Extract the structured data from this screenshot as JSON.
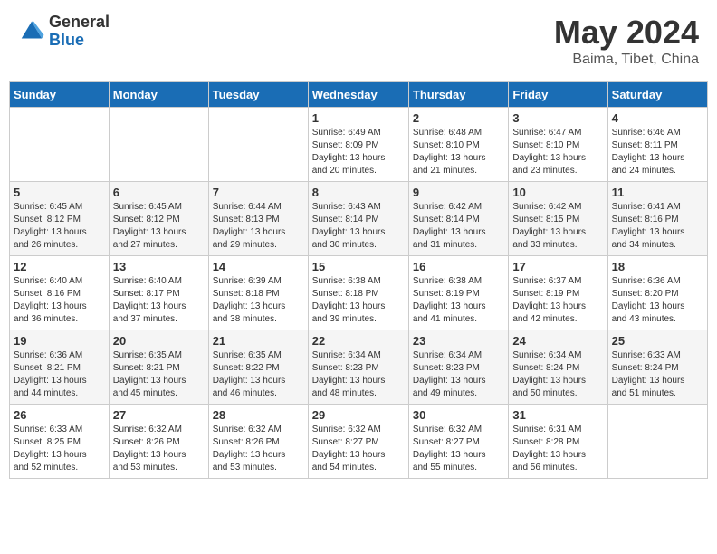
{
  "header": {
    "logo_general": "General",
    "logo_blue": "Blue",
    "month_title": "May 2024",
    "location": "Baima, Tibet, China"
  },
  "weekdays": [
    "Sunday",
    "Monday",
    "Tuesday",
    "Wednesday",
    "Thursday",
    "Friday",
    "Saturday"
  ],
  "weeks": [
    [
      {
        "day": "",
        "info": ""
      },
      {
        "day": "",
        "info": ""
      },
      {
        "day": "",
        "info": ""
      },
      {
        "day": "1",
        "info": "Sunrise: 6:49 AM\nSunset: 8:09 PM\nDaylight: 13 hours\nand 20 minutes."
      },
      {
        "day": "2",
        "info": "Sunrise: 6:48 AM\nSunset: 8:10 PM\nDaylight: 13 hours\nand 21 minutes."
      },
      {
        "day": "3",
        "info": "Sunrise: 6:47 AM\nSunset: 8:10 PM\nDaylight: 13 hours\nand 23 minutes."
      },
      {
        "day": "4",
        "info": "Sunrise: 6:46 AM\nSunset: 8:11 PM\nDaylight: 13 hours\nand 24 minutes."
      }
    ],
    [
      {
        "day": "5",
        "info": "Sunrise: 6:45 AM\nSunset: 8:12 PM\nDaylight: 13 hours\nand 26 minutes."
      },
      {
        "day": "6",
        "info": "Sunrise: 6:45 AM\nSunset: 8:12 PM\nDaylight: 13 hours\nand 27 minutes."
      },
      {
        "day": "7",
        "info": "Sunrise: 6:44 AM\nSunset: 8:13 PM\nDaylight: 13 hours\nand 29 minutes."
      },
      {
        "day": "8",
        "info": "Sunrise: 6:43 AM\nSunset: 8:14 PM\nDaylight: 13 hours\nand 30 minutes."
      },
      {
        "day": "9",
        "info": "Sunrise: 6:42 AM\nSunset: 8:14 PM\nDaylight: 13 hours\nand 31 minutes."
      },
      {
        "day": "10",
        "info": "Sunrise: 6:42 AM\nSunset: 8:15 PM\nDaylight: 13 hours\nand 33 minutes."
      },
      {
        "day": "11",
        "info": "Sunrise: 6:41 AM\nSunset: 8:16 PM\nDaylight: 13 hours\nand 34 minutes."
      }
    ],
    [
      {
        "day": "12",
        "info": "Sunrise: 6:40 AM\nSunset: 8:16 PM\nDaylight: 13 hours\nand 36 minutes."
      },
      {
        "day": "13",
        "info": "Sunrise: 6:40 AM\nSunset: 8:17 PM\nDaylight: 13 hours\nand 37 minutes."
      },
      {
        "day": "14",
        "info": "Sunrise: 6:39 AM\nSunset: 8:18 PM\nDaylight: 13 hours\nand 38 minutes."
      },
      {
        "day": "15",
        "info": "Sunrise: 6:38 AM\nSunset: 8:18 PM\nDaylight: 13 hours\nand 39 minutes."
      },
      {
        "day": "16",
        "info": "Sunrise: 6:38 AM\nSunset: 8:19 PM\nDaylight: 13 hours\nand 41 minutes."
      },
      {
        "day": "17",
        "info": "Sunrise: 6:37 AM\nSunset: 8:19 PM\nDaylight: 13 hours\nand 42 minutes."
      },
      {
        "day": "18",
        "info": "Sunrise: 6:36 AM\nSunset: 8:20 PM\nDaylight: 13 hours\nand 43 minutes."
      }
    ],
    [
      {
        "day": "19",
        "info": "Sunrise: 6:36 AM\nSunset: 8:21 PM\nDaylight: 13 hours\nand 44 minutes."
      },
      {
        "day": "20",
        "info": "Sunrise: 6:35 AM\nSunset: 8:21 PM\nDaylight: 13 hours\nand 45 minutes."
      },
      {
        "day": "21",
        "info": "Sunrise: 6:35 AM\nSunset: 8:22 PM\nDaylight: 13 hours\nand 46 minutes."
      },
      {
        "day": "22",
        "info": "Sunrise: 6:34 AM\nSunset: 8:23 PM\nDaylight: 13 hours\nand 48 minutes."
      },
      {
        "day": "23",
        "info": "Sunrise: 6:34 AM\nSunset: 8:23 PM\nDaylight: 13 hours\nand 49 minutes."
      },
      {
        "day": "24",
        "info": "Sunrise: 6:34 AM\nSunset: 8:24 PM\nDaylight: 13 hours\nand 50 minutes."
      },
      {
        "day": "25",
        "info": "Sunrise: 6:33 AM\nSunset: 8:24 PM\nDaylight: 13 hours\nand 51 minutes."
      }
    ],
    [
      {
        "day": "26",
        "info": "Sunrise: 6:33 AM\nSunset: 8:25 PM\nDaylight: 13 hours\nand 52 minutes."
      },
      {
        "day": "27",
        "info": "Sunrise: 6:32 AM\nSunset: 8:26 PM\nDaylight: 13 hours\nand 53 minutes."
      },
      {
        "day": "28",
        "info": "Sunrise: 6:32 AM\nSunset: 8:26 PM\nDaylight: 13 hours\nand 53 minutes."
      },
      {
        "day": "29",
        "info": "Sunrise: 6:32 AM\nSunset: 8:27 PM\nDaylight: 13 hours\nand 54 minutes."
      },
      {
        "day": "30",
        "info": "Sunrise: 6:32 AM\nSunset: 8:27 PM\nDaylight: 13 hours\nand 55 minutes."
      },
      {
        "day": "31",
        "info": "Sunrise: 6:31 AM\nSunset: 8:28 PM\nDaylight: 13 hours\nand 56 minutes."
      },
      {
        "day": "",
        "info": ""
      }
    ]
  ]
}
